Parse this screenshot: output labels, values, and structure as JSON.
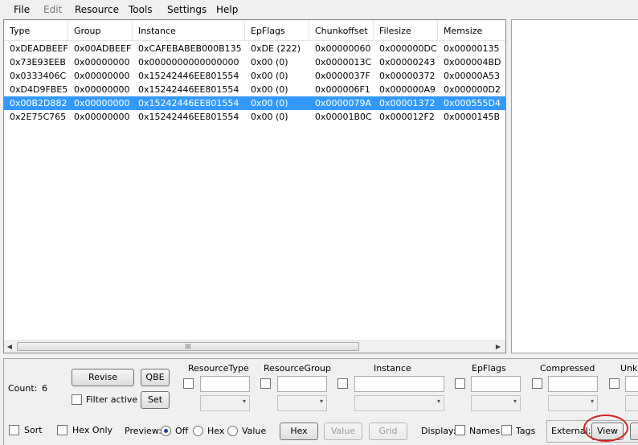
{
  "menu": {
    "items": [
      {
        "label": "File",
        "enabled": true
      },
      {
        "label": "Edit",
        "enabled": false
      },
      {
        "label": "Resource",
        "enabled": true
      },
      {
        "label": "Tools",
        "enabled": true
      },
      {
        "label": "Settings",
        "enabled": true
      },
      {
        "label": "Help",
        "enabled": true
      }
    ]
  },
  "table": {
    "columns": [
      "Type",
      "Group",
      "Instance",
      "EpFlags",
      "Chunkoffset",
      "Filesize",
      "Memsize"
    ],
    "rows": [
      {
        "type": "0xDEADBEEF",
        "group": "0x00ADBEEF",
        "instance": "0xCAFEBABEB000B135",
        "epflags": "0xDE (222)",
        "chunkoffset": "0x00000060",
        "filesize": "0x000000DC",
        "memsize": "0x00000135"
      },
      {
        "type": "0x73E93EEB",
        "group": "0x00000000",
        "instance": "0x0000000000000000",
        "epflags": "0x00 (0)",
        "chunkoffset": "0x0000013C",
        "filesize": "0x00000243",
        "memsize": "0x000004BD"
      },
      {
        "type": "0x0333406C",
        "group": "0x00000000",
        "instance": "0x15242446EE801554",
        "epflags": "0x00 (0)",
        "chunkoffset": "0x0000037F",
        "filesize": "0x00000372",
        "memsize": "0x00000A53"
      },
      {
        "type": "0xD4D9FBE5",
        "group": "0x00000000",
        "instance": "0x15242446EE801554",
        "epflags": "0x00 (0)",
        "chunkoffset": "0x000006F1",
        "filesize": "0x000000A9",
        "memsize": "0x000000D2"
      },
      {
        "type": "0x00B2D882",
        "group": "0x00000000",
        "instance": "0x15242446EE801554",
        "epflags": "0x00 (0)",
        "chunkoffset": "0x0000079A",
        "filesize": "0x00001372",
        "memsize": "0x000555D4"
      },
      {
        "type": "0x2E75C765",
        "group": "0x00000000",
        "instance": "0x15242446EE801554",
        "epflags": "0x00 (0)",
        "chunkoffset": "0x00001B0C",
        "filesize": "0x000012F2",
        "memsize": "0x0000145B"
      }
    ],
    "selected_index": 4,
    "scroll_grip": "III",
    "scroll_left": "◀",
    "scroll_right": "▶"
  },
  "bottom": {
    "count_label": "Count:",
    "count_value": "6",
    "revise_label": "Revise",
    "qbe_label": "QBE",
    "filter_active_label": "Filter active",
    "set_label": "Set",
    "filter_headers": {
      "resource_type": "ResourceType",
      "resource_group": "ResourceGroup",
      "instance": "Instance",
      "epflags": "EpFlags",
      "compressed": "Compressed",
      "unknown": "Unkn"
    },
    "sort_label": "Sort",
    "hex_only_label": "Hex Only",
    "preview_label": "Preview:",
    "preview_options": [
      "Off",
      "Hex",
      "Value"
    ],
    "preview_selected": "Off",
    "hex_button": "Hex",
    "value_button": "Value",
    "grid_button": "Grid",
    "display_label": "Display:",
    "names_label": "Names",
    "tags_label": "Tags",
    "external_label": "External:",
    "view_button": "View",
    "dropdown_arrow": "▾"
  },
  "colors": {
    "selection": "#3399ff",
    "highlight_circle": "#d62020"
  }
}
